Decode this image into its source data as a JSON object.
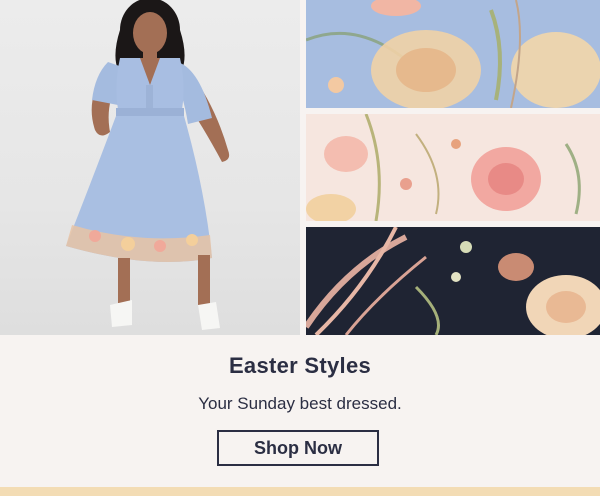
{
  "hero": {
    "model_photo_alt": "",
    "swatches": [
      "blue-floral",
      "cream-floral",
      "navy-floral"
    ]
  },
  "caption": {
    "headline": "Easter Styles",
    "subline": "Your Sunday best dressed.",
    "cta_label": "Shop Now"
  },
  "colors": {
    "text": "#2b2e43",
    "background": "#f7f3f1",
    "accent_band": "#f3dcb4",
    "dress_blue": "#a7bde0"
  }
}
